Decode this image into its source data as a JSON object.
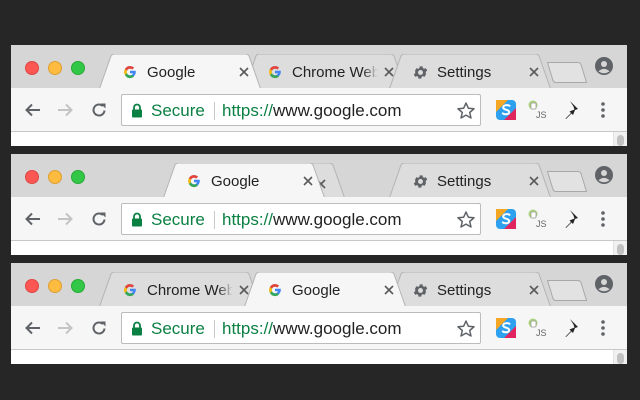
{
  "colors": {
    "background": "#262626",
    "tabstrip": "#d6d6d6",
    "toolbar": "#f6f6f6",
    "secure_green": "#0b8043",
    "traffic_red": "#fc5753",
    "traffic_yellow": "#fdbc40",
    "traffic_green": "#33c748"
  },
  "windows": [
    {
      "tabs": [
        {
          "title": "Google",
          "icon": "google-icon",
          "active": true
        },
        {
          "title": "Chrome Web Store",
          "icon": "google-icon",
          "active": false
        },
        {
          "title": "Settings",
          "icon": "gear-icon",
          "active": false
        }
      ],
      "omnibox": {
        "secure_label": "Secure",
        "url_scheme": "https://",
        "url_host": "www.google.com"
      }
    },
    {
      "tabs": [
        {
          "title": "Google",
          "icon": "google-icon",
          "active": true
        },
        {
          "title": "Settings",
          "icon": "gear-icon",
          "active": false
        }
      ],
      "omnibox": {
        "secure_label": "Secure",
        "url_scheme": "https://",
        "url_host": "www.google.com"
      }
    },
    {
      "tabs": [
        {
          "title": "Chrome Web Store",
          "icon": "google-icon",
          "active": false
        },
        {
          "title": "Google",
          "icon": "google-icon",
          "active": true
        },
        {
          "title": "Settings",
          "icon": "gear-icon",
          "active": false
        }
      ],
      "omnibox": {
        "secure_label": "Secure",
        "url_scheme": "https://",
        "url_host": "www.google.com"
      }
    }
  ],
  "toolbar_icons": [
    "back-arrow-icon",
    "forward-arrow-icon",
    "reload-icon",
    "bookmark-star-icon",
    "menu-dots-icon"
  ],
  "extensions": [
    "skype-extension-icon",
    "js-extension-icon",
    "pin-extension-icon"
  ]
}
